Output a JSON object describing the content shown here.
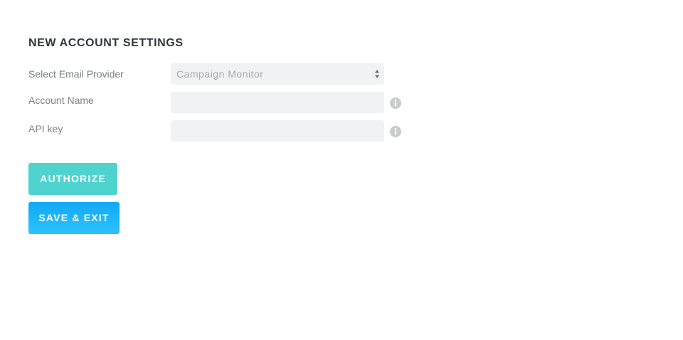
{
  "form": {
    "title": "NEW ACCOUNT SETTINGS",
    "provider": {
      "label": "Select Email Provider",
      "selected": "Campaign Monitor"
    },
    "account_name": {
      "label": "Account Name",
      "value": ""
    },
    "api_key": {
      "label": "API key",
      "value": ""
    }
  },
  "actions": {
    "authorize_label": "AUTHORIZE",
    "save_exit_label": "SAVE & EXIT"
  },
  "colors": {
    "authorize": "#4fd3cf",
    "save_exit": "#1fb5fa",
    "field_bg": "#f1f2f4",
    "info_icon": "#c9cbcf"
  },
  "icons": {
    "select_arrows": "sort-arrows-icon",
    "info": "info-icon"
  }
}
